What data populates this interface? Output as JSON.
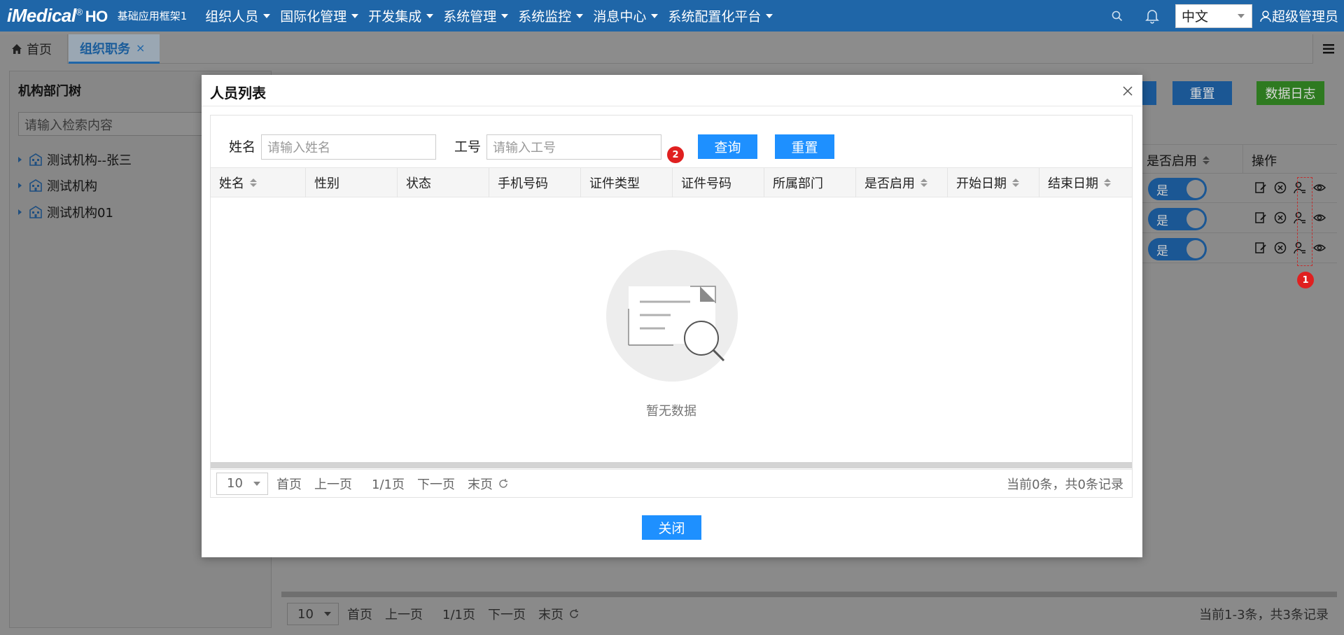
{
  "topbar": {
    "logo": "iMedical",
    "logo_reg": "®",
    "logo_suffix": "HO",
    "app_name": "基础应用框架1",
    "menu": [
      "组织人员",
      "国际化管理",
      "开发集成",
      "系统管理",
      "系统监控",
      "消息中心",
      "系统配置化平台"
    ],
    "language": "中文",
    "user": "超级管理员"
  },
  "tabs": {
    "home": "首页",
    "active": "组织职务",
    "close": "×"
  },
  "left_panel": {
    "title": "机构部门树",
    "search_placeholder": "请输入检索内容",
    "tree": [
      "测试机构--张三",
      "测试机构",
      "测试机构01"
    ]
  },
  "background": {
    "reset_button": "重置",
    "log_button": "数据日志",
    "columns": [
      "是否启用",
      "操作"
    ],
    "rows": [
      {
        "enabled": "是"
      },
      {
        "enabled": "是"
      },
      {
        "enabled": "是"
      }
    ],
    "pager": {
      "size": "10",
      "first": "首页",
      "prev": "上一页",
      "page": "1/1页",
      "next": "下一页",
      "last": "末页",
      "summary": "当前1-3条，共3条记录"
    }
  },
  "markers": {
    "m1": "1",
    "m2": "2"
  },
  "modal": {
    "title": "人员列表",
    "name_label": "姓名",
    "name_placeholder": "请输入姓名",
    "id_label": "工号",
    "id_placeholder": "请输入工号",
    "query_button": "查询",
    "reset_button": "重置",
    "columns": [
      "姓名",
      "性别",
      "状态",
      "手机号码",
      "证件类型",
      "证件号码",
      "所属部门",
      "是否启用",
      "开始日期",
      "结束日期"
    ],
    "empty_text": "暂无数据",
    "pager": {
      "size": "10",
      "first": "首页",
      "prev": "上一页",
      "page": "1/1页",
      "next": "下一页",
      "last": "末页",
      "summary": "当前0条，共0条记录"
    },
    "close_button": "关闭"
  },
  "colors": {
    "brand": "#1f66a8",
    "primary_button": "#1e90ff",
    "log_button": "#3a9a2a",
    "marker": "#e02020"
  }
}
